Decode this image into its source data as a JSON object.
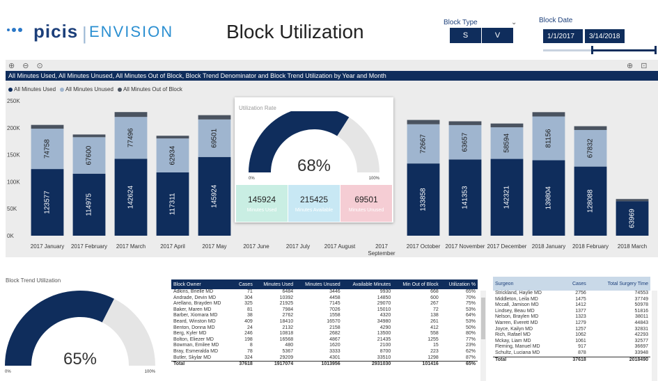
{
  "header": {
    "logo_brand": "picis",
    "logo_sep": "|",
    "logo_product": "ENVISION",
    "title": "Block Utilization"
  },
  "filters": {
    "block_type_label": "Block Type",
    "block_type_options": [
      "S",
      "V"
    ],
    "block_date_label": "Block Date",
    "date_start": "1/1/2017",
    "date_end": "3/14/2018"
  },
  "main_chart": {
    "title": "All Minutes Used, All Minutes Unused, All Minutes Out of Block, Block Trend Denominator and Block Trend Utilization by Year and Month",
    "legend": [
      {
        "label": "All Minutes Used",
        "color": "#0f2d5c"
      },
      {
        "label": "All Minutes Unused",
        "color": "#9fb5cf"
      },
      {
        "label": "All Minutes Out of Block",
        "color": "#4a5360"
      }
    ]
  },
  "chart_data": {
    "type": "bar",
    "stacked": true,
    "categories": [
      "2017 January",
      "2017 February",
      "2017 March",
      "2017 April",
      "2017 May",
      "2017 June",
      "2017 July",
      "2017 August",
      "2017 September",
      "2017 October",
      "2017 November",
      "2017 December",
      "2018 January",
      "2018 February",
      "2018 March"
    ],
    "series": [
      {
        "name": "All Minutes Used",
        "values": [
          123577,
          114975,
          142624,
          117311,
          145924,
          null,
          null,
          null,
          null,
          133858,
          141353,
          142321,
          139804,
          128088,
          63969
        ]
      },
      {
        "name": "All Minutes Unused",
        "values": [
          74758,
          67600,
          77496,
          62934,
          69501,
          null,
          null,
          null,
          null,
          72667,
          63657,
          58594,
          81156,
          67832,
          null
        ]
      },
      {
        "name": "All Minutes Out of Block",
        "values": [
          7000,
          5000,
          9000,
          5000,
          8000,
          null,
          null,
          null,
          null,
          8000,
          7000,
          7000,
          8000,
          7000,
          4000
        ]
      }
    ],
    "yticks": [
      "0K",
      "50K",
      "100K",
      "150K",
      "200K",
      "250K"
    ],
    "ylim": [
      0,
      250000
    ]
  },
  "utilization_card": {
    "title": "Utilization Rate",
    "percent": "68%",
    "scale_min": "0%",
    "scale_max": "100%",
    "fraction": 0.68,
    "kpis": [
      {
        "value": "145924",
        "label": "Minutes Used"
      },
      {
        "value": "215425",
        "label": "Minutes Available"
      },
      {
        "value": "69501",
        "label": "Minutes Unused"
      }
    ]
  },
  "block_trend": {
    "title": "Block Trend Utilization",
    "percent": "65%",
    "scale_min": "0%",
    "scale_max": "100%",
    "fraction": 0.65
  },
  "owner_table": {
    "columns": [
      "Block Owner",
      "Cases",
      "Minutes Used",
      "Minutes Unused",
      "Available Minutes",
      "Min Out of Block",
      "Utilization %"
    ],
    "rows": [
      [
        "Adkins, Brielle MD",
        "71",
        "6484",
        "3446",
        "9930",
        "668",
        "65%"
      ],
      [
        "Andrade, Devin MD",
        "304",
        "10392",
        "4458",
        "14850",
        "600",
        "70%"
      ],
      [
        "Arellano, Brayden MD",
        "325",
        "21925",
        "7145",
        "29070",
        "267",
        "75%"
      ],
      [
        "Baker, Maren MD",
        "81",
        "7984",
        "7026",
        "15010",
        "72",
        "53%"
      ],
      [
        "Barber, Xiomara MD",
        "38",
        "2762",
        "1558",
        "4320",
        "138",
        "64%"
      ],
      [
        "Beard, Winston MD",
        "409",
        "18410",
        "16570",
        "34980",
        "261",
        "53%"
      ],
      [
        "Benton, Donna MD",
        "24",
        "2132",
        "2158",
        "4290",
        "412",
        "50%"
      ],
      [
        "Berg, Kyler MD",
        "246",
        "10818",
        "2682",
        "13500",
        "558",
        "80%"
      ],
      [
        "Bolton, Eliezer MD",
        "198",
        "16568",
        "4867",
        "21435",
        "1255",
        "77%"
      ],
      [
        "Bowman, Emilee MD",
        "8",
        "480",
        "1620",
        "2100",
        "15",
        "23%"
      ],
      [
        "Bray, Esmeralda MD",
        "78",
        "5367",
        "3333",
        "8700",
        "223",
        "62%"
      ],
      [
        "Butler, Skylar MD",
        "324",
        "29209",
        "4301",
        "33510",
        "1298",
        "87%"
      ]
    ],
    "total": [
      "Total",
      "37618",
      "1917074",
      "1013956",
      "2931030",
      "101416",
      "65%"
    ]
  },
  "surgeon_table": {
    "columns": [
      "Surgeon",
      "Cases",
      "Total Surgery Time"
    ],
    "rows": [
      [
        "Strickland, Haylie MD",
        "2756",
        "74553"
      ],
      [
        "Middleton, Leila MD",
        "1475",
        "37749"
      ],
      [
        "Mccall, Jamison MD",
        "1412",
        "50978"
      ],
      [
        "Lindsey, Beau MD",
        "1377",
        "51816"
      ],
      [
        "Nelson, Braylen MD",
        "1323",
        "38011"
      ],
      [
        "Warren, Everett MD",
        "1279",
        "44843"
      ],
      [
        "Joyce, Kailyn MD",
        "1257",
        "32831"
      ],
      [
        "Rich, Rafael MD",
        "1062",
        "42293"
      ],
      [
        "Mckay, Liam MD",
        "1061",
        "32577"
      ],
      [
        "Fleming, Manuel MD",
        "917",
        "36697"
      ],
      [
        "Schultz, Luciana MD",
        "878",
        "33948"
      ]
    ],
    "total": [
      "Total",
      "37618",
      "2018490"
    ]
  },
  "icons": {
    "chart_left": "⊕ ⊖ ⊙",
    "chart_right": "⊕ ⊡ ⋯",
    "chevron": "⌄"
  }
}
